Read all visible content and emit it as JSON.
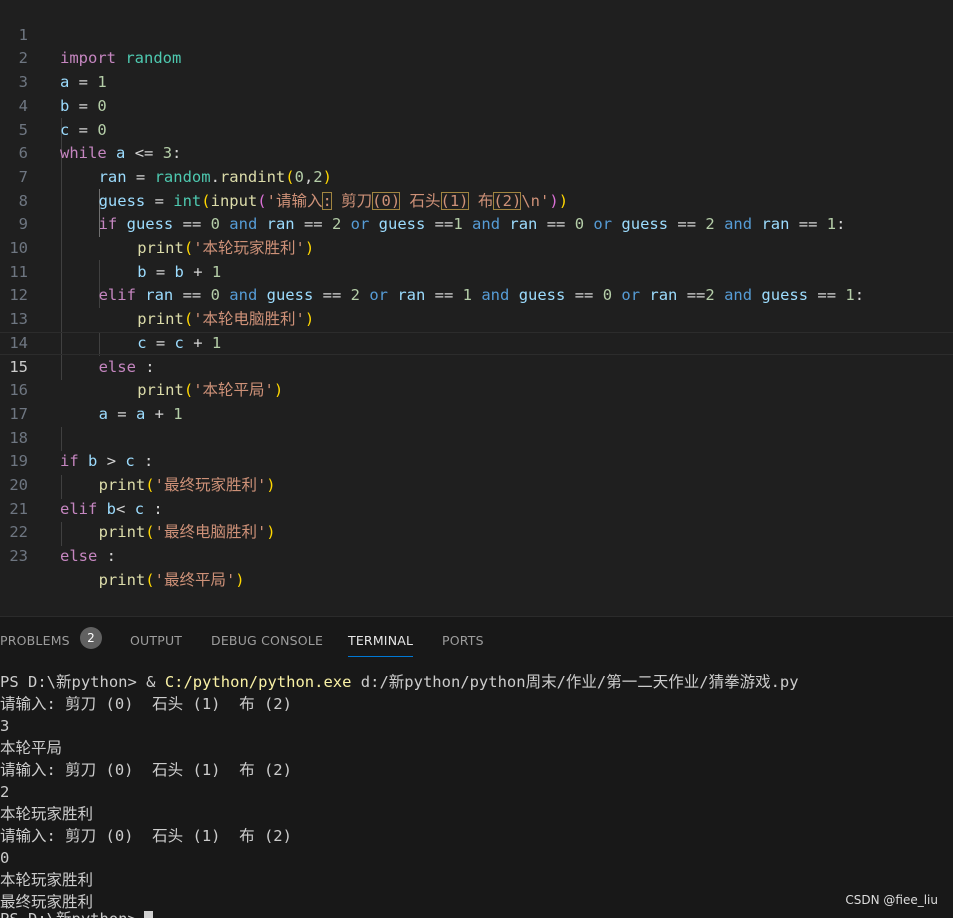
{
  "editor": {
    "line_numbers": [
      "1",
      "2",
      "3",
      "4",
      "5",
      "6",
      "7",
      "8",
      "9",
      "10",
      "11",
      "12",
      "13",
      "14",
      "15",
      "16",
      "17",
      "18",
      "19",
      "20",
      "21",
      "22",
      "23"
    ],
    "tokens": {
      "import": "import",
      "random": "random",
      "a": "a",
      "b": "b",
      "c": "c",
      "eq": " = ",
      "v1": "1",
      "v0": "0",
      "v2": "2",
      "v3": "3",
      "while": "while",
      "le": " <= ",
      "colon": ":",
      "ran": "ran",
      "randint": "randint",
      "dot": ".",
      "lp": "(",
      "rp": ")",
      "comma": ",",
      "guess": "guess",
      "int": "int",
      "input": "input",
      "prompt_a": "'请输入",
      "prompt_b": ":",
      "prompt_c": " 剪刀",
      "prompt_d": "(0)",
      "prompt_e": " 石头",
      "prompt_f": "(1)",
      "prompt_g": " 布",
      "prompt_h": "(2)",
      "prompt_i": "\\n'",
      "if": "if",
      "elif": "elif",
      "else": "else",
      "and": "and",
      "or": "or",
      "eqeq": " == ",
      "eqeq_tight": " ==",
      "print": "print",
      "plus": " + ",
      "gt": " > ",
      "lt": "< ",
      "sp": " ",
      "s_round_player": "'本轮玩家胜利'",
      "s_round_pc": "'本轮电脑胜利'",
      "s_round_draw": "'本轮平局'",
      "s_final_player": "'最终玩家胜利'",
      "s_final_pc": "'最终电脑胜利'",
      "s_final_draw": "'最终平局'"
    },
    "current_line": "15"
  },
  "panel": {
    "tabs": {
      "problems": "PROBLEMS",
      "problems_count": "2",
      "output": "OUTPUT",
      "debug_console": "DEBUG CONSOLE",
      "terminal": "TERMINAL",
      "ports": "PORTS"
    },
    "terminal": {
      "prompt": "PS D:\\新python> & ",
      "exe": "C:/python/python.exe",
      "script": " d:/新python/python周末/作业/第一二天作业/猜拳游戏.py",
      "lines": [
        "请输入: 剪刀 (0)  石头 (1)  布 (2)",
        "3",
        "本轮平局",
        "请输入: 剪刀 (0)  石头 (1)  布 (2)",
        "2",
        "本轮玩家胜利",
        "请输入: 剪刀 (0)  石头 (1)  布 (2)",
        "0",
        "本轮玩家胜利",
        "最终玩家胜利"
      ],
      "last_partial": "PS D:\\新python>"
    }
  },
  "watermark": "CSDN @fiee_liu"
}
